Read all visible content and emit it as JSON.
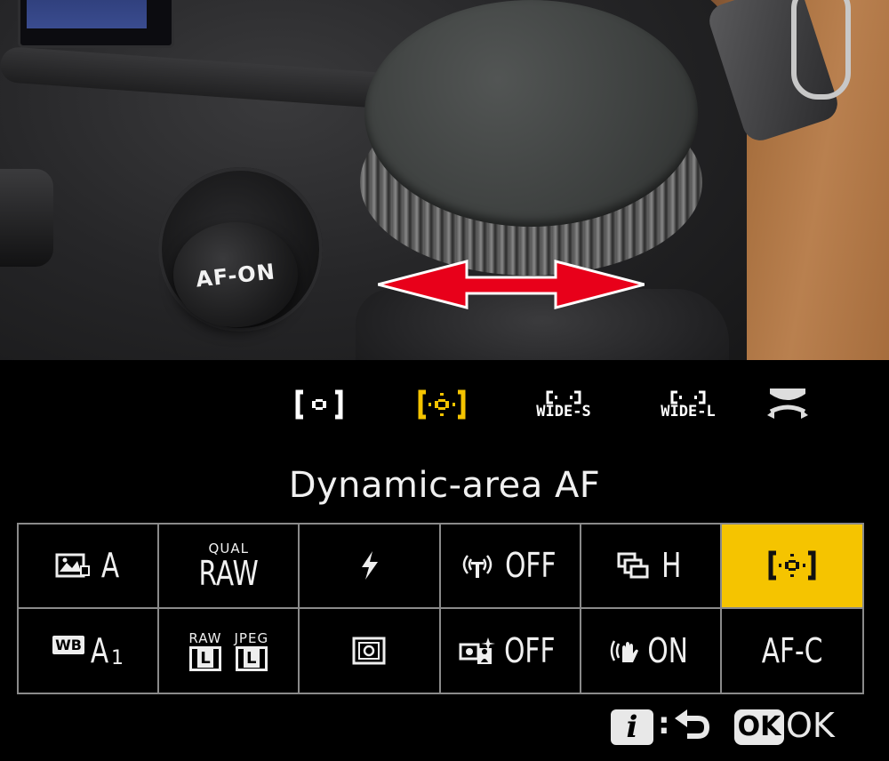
{
  "photo": {
    "button_label": "AF-ON",
    "arrow_color": "#e8001a"
  },
  "mode_bar": {
    "items": [
      {
        "id": "single-point",
        "label": ""
      },
      {
        "id": "dynamic-area",
        "label": "",
        "selected": true
      },
      {
        "id": "wide-s",
        "label": "WIDE-S"
      },
      {
        "id": "wide-l",
        "label": "WIDE-L"
      },
      {
        "id": "auto-area",
        "label": ""
      }
    ],
    "accent_color": "#f5c400"
  },
  "title": "Dynamic-area AF",
  "grid": {
    "row1": [
      {
        "id": "picture-control",
        "value": "A"
      },
      {
        "id": "image-quality",
        "caption": "QUAL",
        "value": "RAW"
      },
      {
        "id": "flash-mode",
        "value": ""
      },
      {
        "id": "wireless",
        "value": "OFF"
      },
      {
        "id": "release-mode",
        "value": "H"
      },
      {
        "id": "af-area-mode",
        "value": "",
        "active": true
      }
    ],
    "row2": [
      {
        "id": "white-balance",
        "prefix": "WB",
        "value": "A",
        "sub": "1"
      },
      {
        "id": "image-size",
        "caption_left": "RAW",
        "caption_right": "JPEG",
        "left": "L",
        "right": "L"
      },
      {
        "id": "metering",
        "value": ""
      },
      {
        "id": "silent-photo",
        "value": "OFF"
      },
      {
        "id": "vibration-reduction",
        "value": "ON"
      },
      {
        "id": "focus-mode",
        "value": "AF-C"
      }
    ]
  },
  "footer": {
    "info_key": "i",
    "colon": ":",
    "ok_key": "OK",
    "ok_label": "OK"
  }
}
